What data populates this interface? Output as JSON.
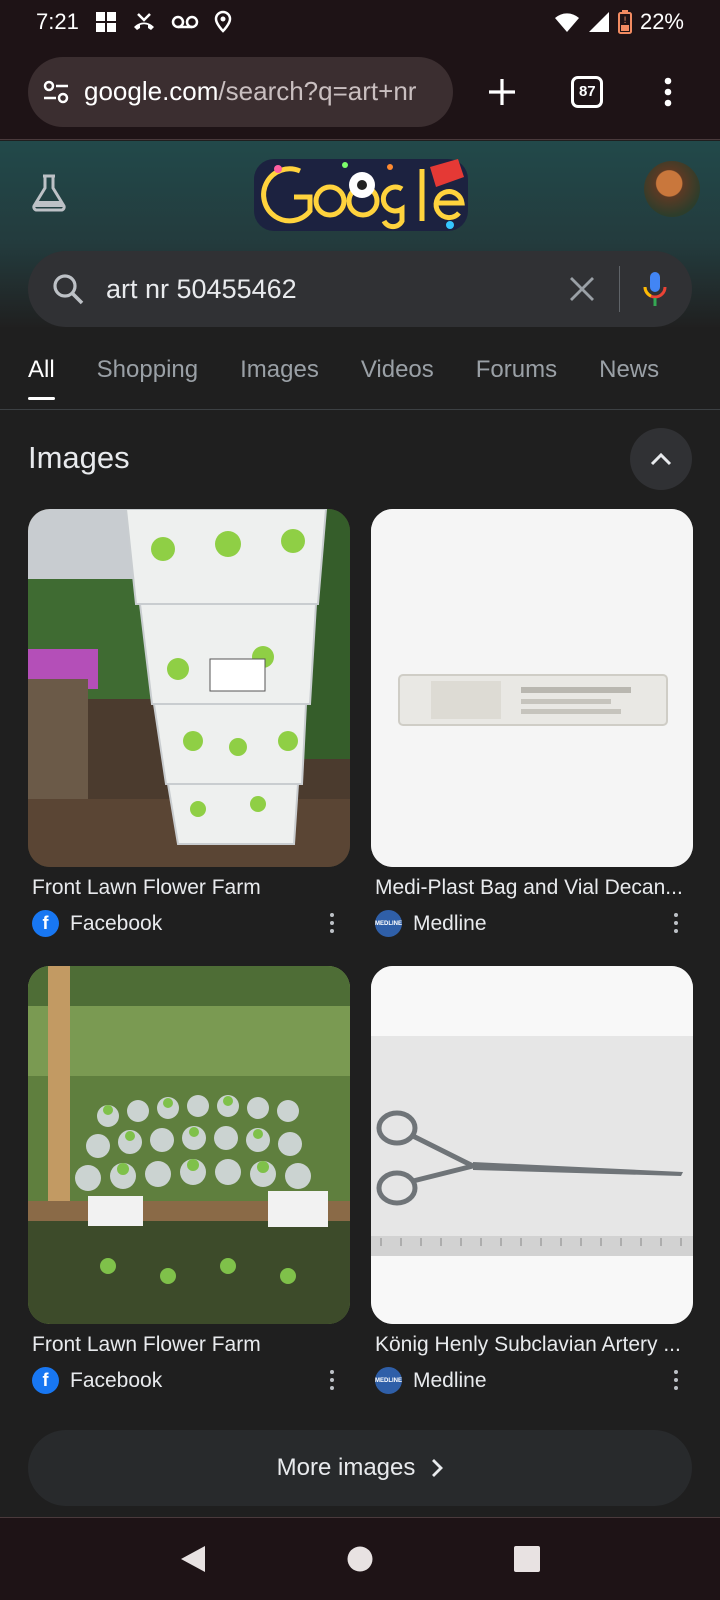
{
  "status_bar": {
    "time": "7:21",
    "battery": "22%"
  },
  "browser": {
    "url_host": "google.com",
    "url_path": "/search?q=art+nr",
    "tab_count": "87"
  },
  "search": {
    "query": "art nr 50455462"
  },
  "tabs": [
    {
      "label": "All",
      "active": true
    },
    {
      "label": "Shopping"
    },
    {
      "label": "Images"
    },
    {
      "label": "Videos"
    },
    {
      "label": "Forums"
    },
    {
      "label": "News"
    }
  ],
  "images_section": {
    "title": "Images",
    "results": [
      {
        "title": "Front Lawn Flower Farm",
        "source": "Facebook"
      },
      {
        "title": "Medi-Plast Bag and Vial Decan...",
        "source": "Medline"
      },
      {
        "title": "Front Lawn Flower Farm",
        "source": "Facebook"
      },
      {
        "title": "König Henly Subclavian Artery ...",
        "source": "Medline"
      }
    ],
    "more_label": "More images"
  },
  "colors": {
    "background": "#1f1f1f",
    "facebook": "#1877f2",
    "chrome_toolbar": "#1e1316"
  }
}
